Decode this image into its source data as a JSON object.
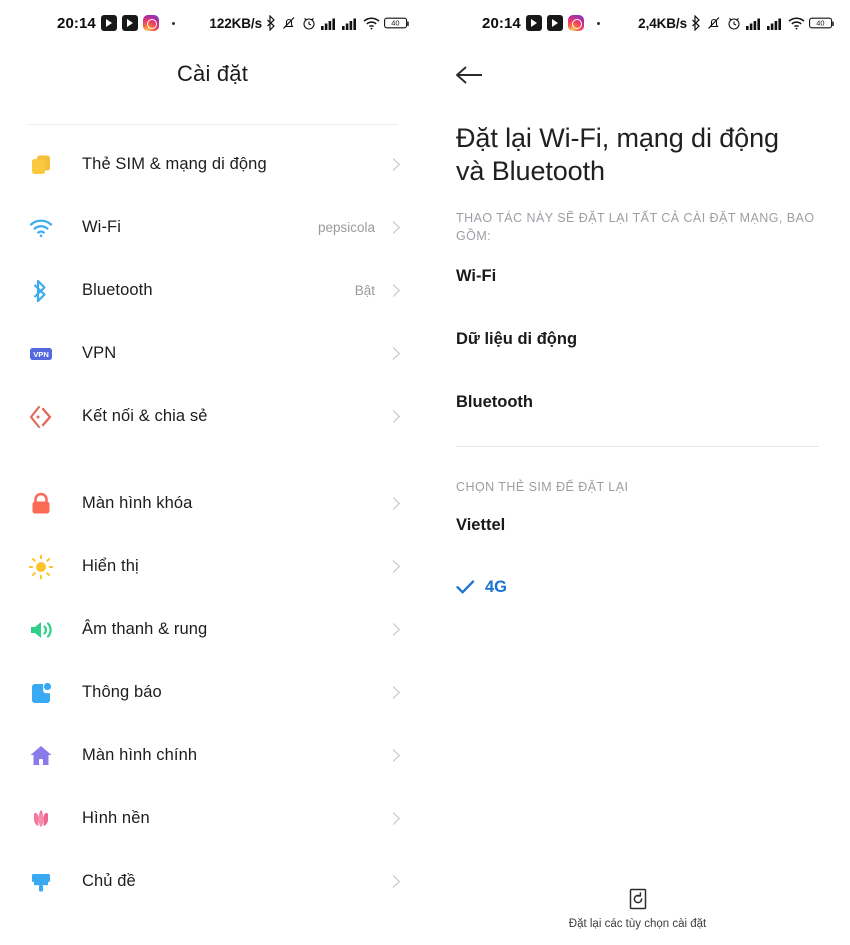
{
  "left": {
    "status_bar": {
      "time": "20:14",
      "network_speed": "122KB/s",
      "battery_level": "40",
      "app_icons": [
        "youtube-icon",
        "youtube-icon",
        "instagram-icon"
      ],
      "system_icons": [
        "bluetooth-icon",
        "mute-bell-icon",
        "alarm-icon",
        "signal-icon",
        "signal-icon",
        "wifi-icon",
        "battery-icon"
      ]
    },
    "title": "Cài đặt",
    "groups": [
      {
        "items": [
          {
            "label": "Thẻ SIM & mạng di động",
            "value": "",
            "icon": "sim-card-icon",
            "color": "#f7be3a"
          },
          {
            "label": "Wi-Fi",
            "value": "pepsicola",
            "icon": "wifi-icon",
            "color": "#3bacf0"
          },
          {
            "label": "Bluetooth",
            "value": "Bật",
            "icon": "bluetooth-icon",
            "color": "#3bacf0"
          },
          {
            "label": "VPN",
            "value": "",
            "icon": "vpn-icon",
            "color": "#5468e0"
          },
          {
            "label": "Kết nối & chia sẻ",
            "value": "",
            "icon": "share-icon",
            "color": "#e06a5c"
          }
        ]
      },
      {
        "items": [
          {
            "label": "Màn hình khóa",
            "value": "",
            "icon": "lock-icon",
            "color": "#fa6a55"
          },
          {
            "label": "Hiển thị",
            "value": "",
            "icon": "brightness-icon",
            "color": "#fcc42b"
          },
          {
            "label": "Âm thanh & rung",
            "value": "",
            "icon": "speaker-icon",
            "color": "#2ecf87"
          },
          {
            "label": "Thông báo",
            "value": "",
            "icon": "notification-icon",
            "color": "#39a9f4"
          },
          {
            "label": "Màn hình chính",
            "value": "",
            "icon": "home-icon",
            "color": "#8b7bea"
          },
          {
            "label": "Hình nền",
            "value": "",
            "icon": "tulip-icon",
            "color": "#f06a92"
          },
          {
            "label": "Chủ đề",
            "value": "",
            "icon": "paintbrush-icon",
            "color": "#39a9f4"
          }
        ]
      }
    ]
  },
  "right": {
    "status_bar": {
      "time": "20:14",
      "network_speed": "2,4KB/s",
      "battery_level": "40"
    },
    "back_label": "back-arrow",
    "title": "Đặt lại Wi-Fi, mạng di động và Bluetooth",
    "caption": "THAO TÁC NÀY SẼ ĐẶT LẠI TẤT CẢ CÀI ĐẶT MẠNG, BAO GỒM:",
    "reset_items": [
      "Wi-Fi",
      "Dữ liệu di động",
      "Bluetooth"
    ],
    "sim_caption": "CHỌN THẺ SIM ĐỂ ĐẶT LẠI",
    "sim_items": [
      {
        "label": "Viettel",
        "selected": false
      },
      {
        "label": "4G",
        "selected": true
      }
    ],
    "bottom_action": {
      "label": "Đặt lại các tùy chọn cài đặt",
      "icon": "reset-icon"
    },
    "accent_color": "#1a73d4"
  }
}
